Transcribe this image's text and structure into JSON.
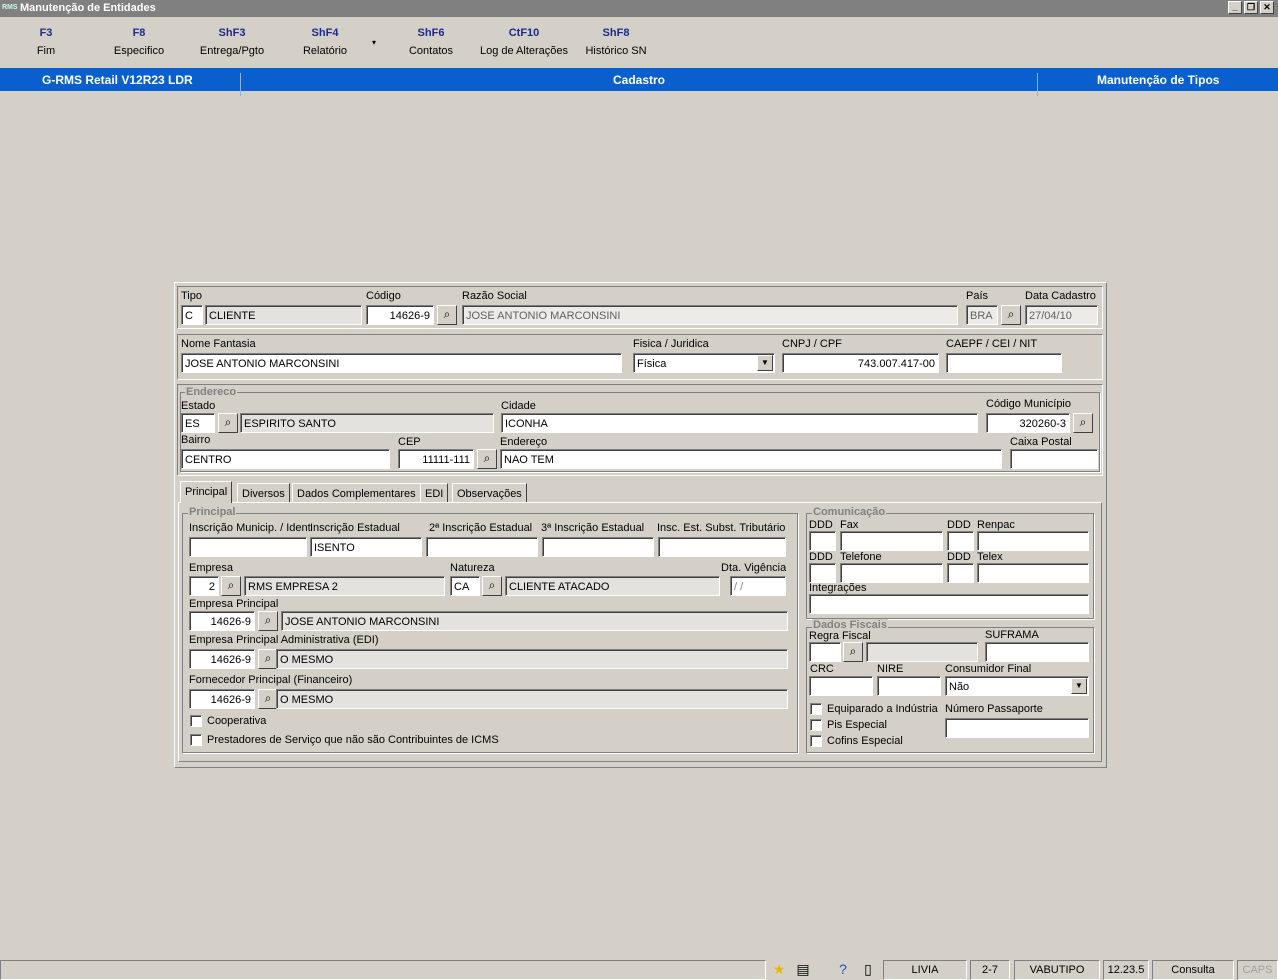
{
  "window": {
    "title": "Manutenção de Entidades",
    "app_icon_text": "RMS"
  },
  "toolbar": [
    {
      "key": "F3",
      "label": "Fim"
    },
    {
      "key": "F8",
      "label": "Especifico"
    },
    {
      "key": "ShF3",
      "label": "Entrega/Pgto"
    },
    {
      "key": "ShF4",
      "label": "Relatório"
    },
    {
      "key": "ShF6",
      "label": "Contatos"
    },
    {
      "key": "CtF10",
      "label": "Log de Alterações"
    },
    {
      "key": "ShF8",
      "label": "Histórico SN"
    }
  ],
  "header": {
    "system": "G-RMS Retail V12R23 LDR",
    "module": "Cadastro",
    "screen": "Manutenção de Tipos"
  },
  "top": {
    "tipo_label": "Tipo",
    "tipo_code": "C",
    "tipo_desc": "CLIENTE",
    "codigo_label": "Código",
    "codigo": "14626-9",
    "razao_label": "Razão Social",
    "razao": "JOSE ANTONIO MARCONSINI",
    "pais_label": "País",
    "pais": "BRA",
    "data_label": "Data Cadastro",
    "data": "27/04/10"
  },
  "ident": {
    "fantasia_label": "Nome Fantasia",
    "fantasia": "JOSE ANTONIO MARCONSINI",
    "fisjur_label": "Fisica / Juridica",
    "fisjur": "Física",
    "cnpj_label": "CNPJ / CPF",
    "cnpj": "743.007.417-00",
    "caepf_label": "CAEPF / CEI / NIT",
    "caepf": ""
  },
  "endereco": {
    "group": "Endereco",
    "estado_label": "Estado",
    "estado": "ES",
    "estado_nome": "ESPIRITO SANTO",
    "cidade_label": "Cidade",
    "cidade": "ICONHA",
    "codmun_label": "Código Município",
    "codmun": "320260-3",
    "bairro_label": "Bairro",
    "bairro": "CENTRO",
    "cep_label": "CEP",
    "cep": "11111-111",
    "end_label": "Endereço",
    "end": "NAO TEM",
    "cxp_label": "Caixa Postal",
    "cxp": ""
  },
  "tabs": [
    "Principal",
    "Diversos",
    "Dados Complementares",
    "EDI",
    "Observações"
  ],
  "principal": {
    "group": "Principal",
    "insc_mun_label": "Inscrição Municip. / Ident",
    "insc_mun": "",
    "insc_est_label": "Inscrição Estadual",
    "insc_est": "ISENTO",
    "insc2_label": "2ª Inscrição Estadual",
    "insc2": "",
    "insc3_label": "3ª Inscrição Estadual",
    "insc3": "",
    "insc_subst_label": "Insc. Est. Subst. Tributário",
    "insc_subst": "",
    "empresa_label": "Empresa",
    "empresa": "2",
    "empresa_nome": "RMS EMPRESA 2",
    "natureza_label": "Natureza",
    "natureza": "CA",
    "natureza_nome": "CLIENTE ATACADO",
    "vigencia_label": "Dta. Vigência",
    "vigencia": " / /",
    "emp_princ_label": "Empresa Principal",
    "emp_princ": "14626-9",
    "emp_princ_nome": "JOSE ANTONIO MARCONSINI",
    "emp_adm_label": "Empresa Principal Administrativa (EDI)",
    "emp_adm": "14626-9",
    "emp_adm_nome": "O MESMO",
    "forn_label": "Fornecedor Principal (Financeiro)",
    "forn": "14626-9",
    "forn_nome": "O MESMO",
    "coop_label": "Cooperativa",
    "prest_label": "Prestadores de Serviço que não são Contribuintes de ICMS"
  },
  "comunicacao": {
    "group": "Comunicação",
    "ddd": "DDD",
    "fax": "Fax",
    "renpac": "Renpac",
    "telefone": "Telefone",
    "telex": "Telex",
    "integracoes": "Integrações"
  },
  "fiscais": {
    "group": "Dados Fiscais",
    "regra_label": "Regra Fiscal",
    "suframa_label": "SUFRAMA",
    "crc_label": "CRC",
    "nire_label": "NIRE",
    "consumidor_label": "Consumidor Final",
    "consumidor": "Não",
    "equip_label": "Equiparado a Indústria",
    "pis_label": "Pis Especial",
    "cofins_label": "Cofins Especial",
    "passaporte_label": "Número Passaporte"
  },
  "status": {
    "user": "LIVIA",
    "code": "2-7",
    "program": "VABUTIPO",
    "version": "12.23.5",
    "mode": "Consulta",
    "caps": "CAPS"
  }
}
